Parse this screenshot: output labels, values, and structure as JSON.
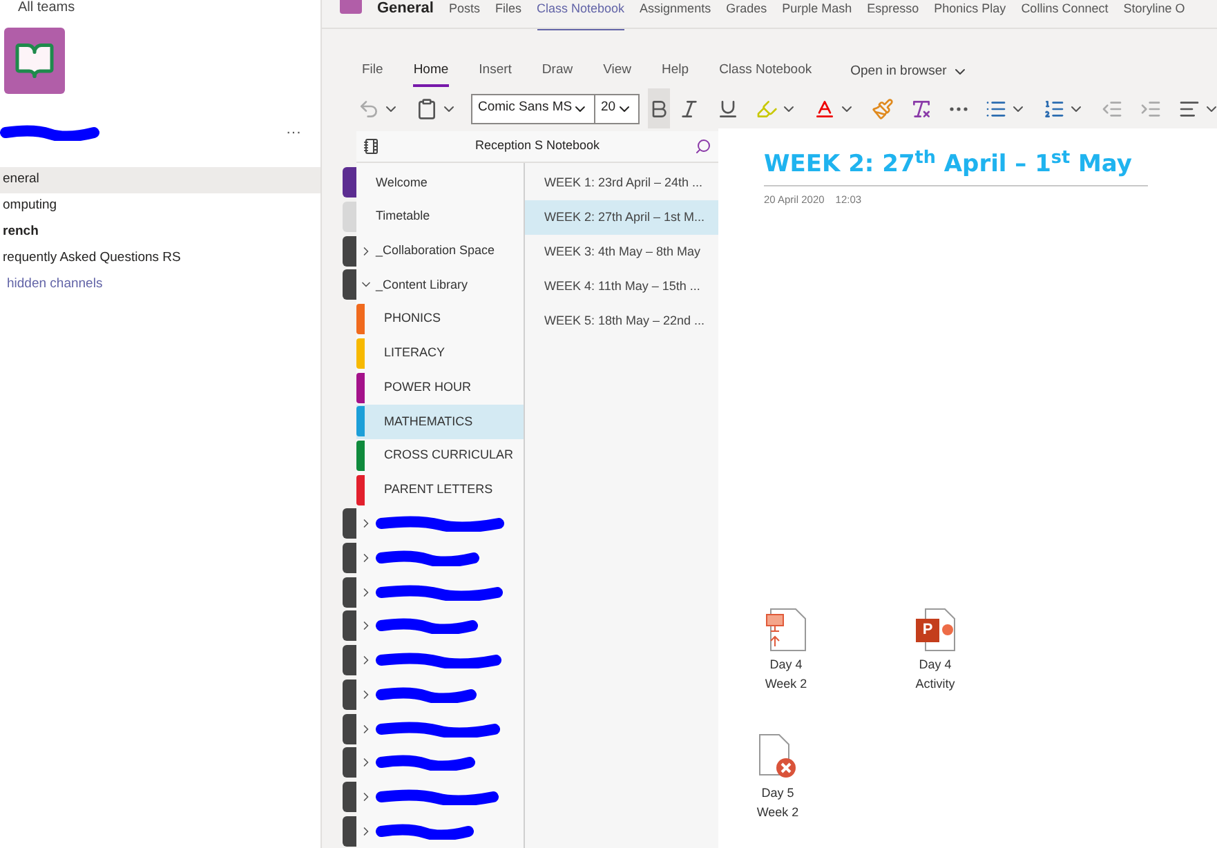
{
  "teams_pane": {
    "back_link": "All teams",
    "team_name_redacted": true,
    "more": "···",
    "channels": [
      {
        "label": "eneral",
        "selected": true,
        "unread": false
      },
      {
        "label": "omputing",
        "selected": false,
        "unread": false
      },
      {
        "label": "rench",
        "selected": false,
        "unread": true
      },
      {
        "label": "requently Asked Questions RS",
        "selected": false,
        "unread": false
      }
    ],
    "hidden_link": "hidden channels"
  },
  "channel_tabs": [
    {
      "label": "General",
      "kind": "title"
    },
    {
      "label": "Posts",
      "kind": "tab",
      "selected": false
    },
    {
      "label": "Files",
      "kind": "tab",
      "selected": false
    },
    {
      "label": "Class Notebook",
      "kind": "tab",
      "selected": true
    },
    {
      "label": "Assignments",
      "kind": "tab",
      "selected": false
    },
    {
      "label": "Grades",
      "kind": "tab",
      "selected": false
    },
    {
      "label": "Purple Mash",
      "kind": "tab",
      "selected": false
    },
    {
      "label": "Espresso",
      "kind": "tab",
      "selected": false
    },
    {
      "label": "Phonics Play",
      "kind": "tab",
      "selected": false
    },
    {
      "label": "Collins Connect",
      "kind": "tab",
      "selected": false
    },
    {
      "label": "Storyline O",
      "kind": "tab",
      "selected": false
    }
  ],
  "ribbon_tabs": [
    {
      "label": "File",
      "selected": false
    },
    {
      "label": "Home",
      "selected": true
    },
    {
      "label": "Insert",
      "selected": false
    },
    {
      "label": "Draw",
      "selected": false
    },
    {
      "label": "View",
      "selected": false
    },
    {
      "label": "Help",
      "selected": false
    },
    {
      "label": "Class Notebook",
      "selected": false
    }
  ],
  "open_in_browser": "Open in browser",
  "toolbar": {
    "font": "Comic Sans MS",
    "size": "20",
    "bold_pressed": true
  },
  "notebook": {
    "title": "Reception S Notebook",
    "sections": [
      {
        "label": "Welcome",
        "color": "#5c2d91",
        "kind": "section",
        "selected": false
      },
      {
        "label": "Timetable",
        "color": "#d8d8d8",
        "kind": "section",
        "selected": false
      },
      {
        "label": "_Collaboration Space",
        "color": "#444444",
        "kind": "group",
        "expanded": false
      },
      {
        "label": "_Content Library",
        "color": "#444444",
        "kind": "group",
        "expanded": true,
        "children": [
          {
            "label": "PHONICS",
            "color": "#f06a1e",
            "selected": false
          },
          {
            "label": "LITERACY",
            "color": "#f7b900",
            "selected": false
          },
          {
            "label": "POWER HOUR",
            "color": "#a4128a",
            "selected": false
          },
          {
            "label": "MATHEMATICS",
            "color": "#1c9fd8",
            "selected": true
          },
          {
            "label": "CROSS CURRICULAR",
            "color": "#0f8a3c",
            "selected": false
          },
          {
            "label": "PARENT LETTERS",
            "color": "#e2202d",
            "selected": false
          }
        ]
      },
      {
        "kind": "redacted",
        "color": "#444444",
        "expanded": false
      },
      {
        "kind": "redacted",
        "color": "#444444",
        "expanded": false
      },
      {
        "kind": "redacted",
        "color": "#444444",
        "expanded": false
      },
      {
        "kind": "redacted",
        "color": "#444444",
        "expanded": false
      },
      {
        "kind": "redacted",
        "color": "#444444",
        "expanded": false
      },
      {
        "kind": "redacted",
        "color": "#444444",
        "expanded": false
      },
      {
        "kind": "redacted",
        "color": "#444444",
        "expanded": false
      },
      {
        "kind": "redacted",
        "color": "#444444",
        "expanded": false
      },
      {
        "kind": "redacted",
        "color": "#444444",
        "expanded": false
      },
      {
        "kind": "redacted",
        "color": "#444444",
        "expanded": false
      }
    ],
    "pages": [
      {
        "label": "WEEK 1: 23rd April – 24th ...",
        "selected": false
      },
      {
        "label": "WEEK 2: 27th April – 1st M...",
        "selected": true
      },
      {
        "label": "WEEK 3: 4th May – 8th May",
        "selected": false
      },
      {
        "label": "WEEK 4: 11th May – 15th ...",
        "selected": false
      },
      {
        "label": "WEEK 5: 18th May – 22nd ...",
        "selected": false
      }
    ]
  },
  "page": {
    "title": "WEEK 2: 27$^{th}$ April – 1$^{st}$ May",
    "date": "20 April 2020",
    "time": "12:03",
    "attachments": [
      {
        "kind": "presentation",
        "lines": [
          "Day 4",
          "Week 2"
        ]
      },
      {
        "kind": "powerpoint",
        "letter": "P",
        "lines": [
          "Day 4",
          "Activity"
        ]
      },
      {
        "kind": "error",
        "lines": [
          "Day 5",
          "Week 2"
        ]
      }
    ]
  }
}
